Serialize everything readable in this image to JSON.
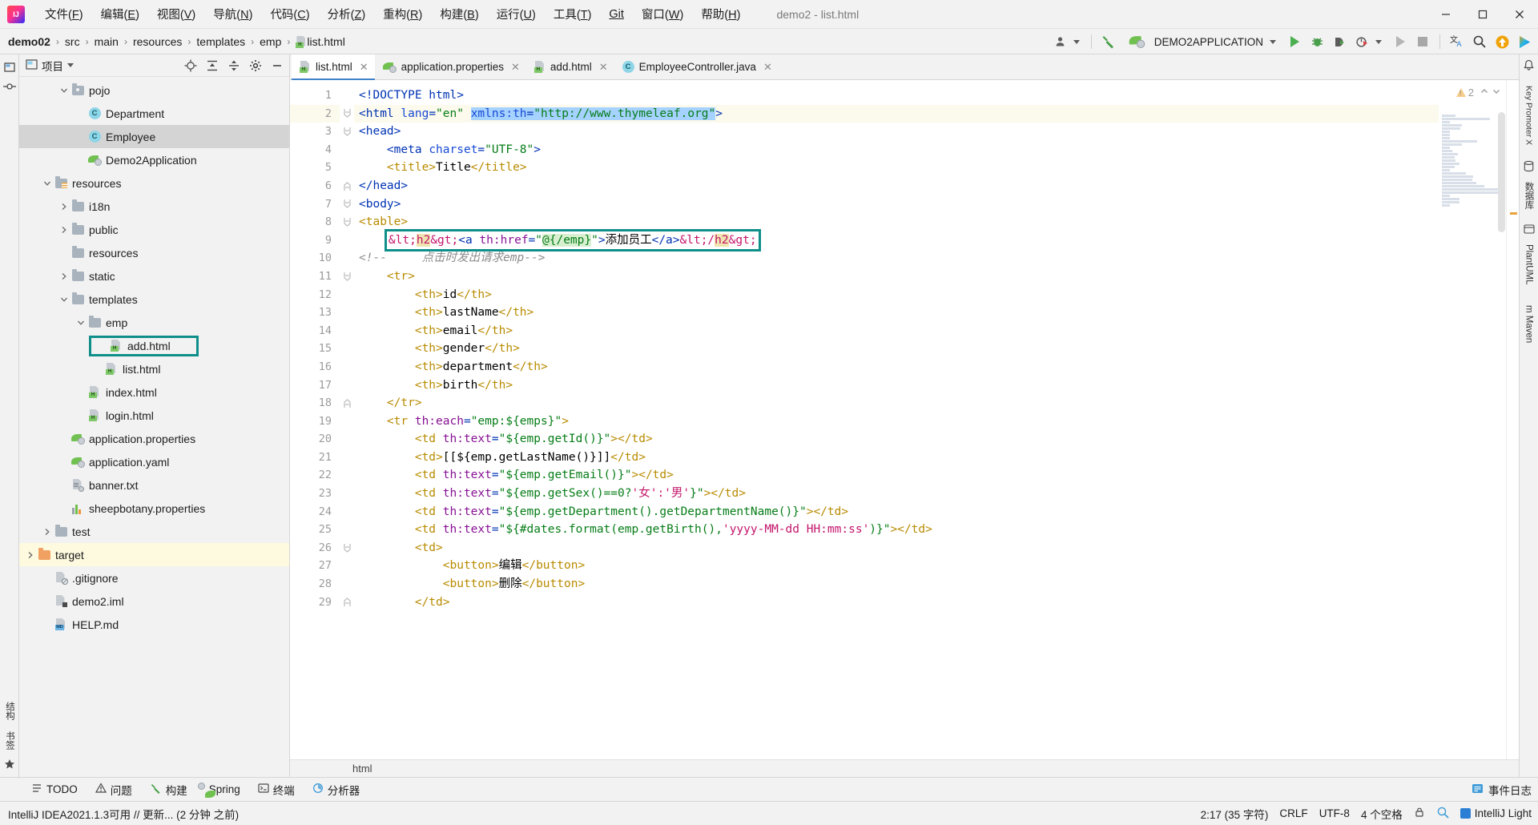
{
  "window": {
    "title": "demo2 - list.html",
    "controls": [
      "minimize",
      "maximize",
      "close"
    ]
  },
  "menubar": {
    "items": [
      {
        "label": "文件(F)",
        "name": "menu-file"
      },
      {
        "label": "编辑(E)",
        "name": "menu-edit"
      },
      {
        "label": "视图(V)",
        "name": "menu-view"
      },
      {
        "label": "导航(N)",
        "name": "menu-navigate"
      },
      {
        "label": "代码(C)",
        "name": "menu-code"
      },
      {
        "label": "分析(Z)",
        "name": "menu-analyze"
      },
      {
        "label": "重构(R)",
        "name": "menu-refactor"
      },
      {
        "label": "构建(B)",
        "name": "menu-build"
      },
      {
        "label": "运行(U)",
        "name": "menu-run"
      },
      {
        "label": "工具(T)",
        "name": "menu-tools"
      },
      {
        "label": "Git",
        "name": "menu-git"
      },
      {
        "label": "窗口(W)",
        "name": "menu-window"
      },
      {
        "label": "帮助(H)",
        "name": "menu-help"
      }
    ]
  },
  "breadcrumbs": {
    "items": [
      "demo02",
      "src",
      "main",
      "resources",
      "templates",
      "emp",
      "list.html"
    ],
    "separator": "›"
  },
  "toolbar": {
    "run_config": "DEMO2APPLICATION",
    "icons": [
      "user-icon",
      "hammer-build-icon",
      "spring-boot-icon",
      "run-icon",
      "debug-icon",
      "run-with-coverage-icon",
      "profile-icon",
      "rerun-icon",
      "stop-icon",
      "translate-icon",
      "search-everywhere-icon",
      "update-project-icon",
      "ide-features-icon"
    ]
  },
  "project_panel": {
    "title": "项目",
    "header_icons": [
      "locate-icon",
      "expand-all-icon",
      "collapse-all-icon",
      "settings-icon",
      "hide-icon"
    ],
    "tree": [
      {
        "label": "pojo",
        "indent": 3,
        "icon": "package-folder-icon",
        "twist": "down",
        "state": "normal"
      },
      {
        "label": "Department",
        "indent": 4,
        "icon": "class-icon",
        "twist": "none",
        "state": "normal"
      },
      {
        "label": "Employee",
        "indent": 4,
        "icon": "class-icon",
        "twist": "none",
        "state": "selected"
      },
      {
        "label": "Demo2Application",
        "indent": 4,
        "icon": "spring-icon",
        "twist": "none",
        "state": "normal"
      },
      {
        "label": "resources",
        "indent": 2,
        "icon": "resource-folder-icon",
        "twist": "down",
        "state": "normal"
      },
      {
        "label": "i18n",
        "indent": 3,
        "icon": "folder-icon",
        "twist": "right",
        "state": "normal"
      },
      {
        "label": "public",
        "indent": 3,
        "icon": "folder-icon",
        "twist": "right",
        "state": "normal"
      },
      {
        "label": "resources",
        "indent": 3,
        "icon": "folder-icon",
        "twist": "none",
        "state": "normal"
      },
      {
        "label": "static",
        "indent": 3,
        "icon": "folder-icon",
        "twist": "right",
        "state": "normal"
      },
      {
        "label": "templates",
        "indent": 3,
        "icon": "folder-icon",
        "twist": "down",
        "state": "normal"
      },
      {
        "label": "emp",
        "indent": 4,
        "icon": "folder-icon",
        "twist": "down",
        "state": "normal"
      },
      {
        "label": "add.html",
        "indent": 5,
        "icon": "html-icon",
        "twist": "none",
        "state": "boxed"
      },
      {
        "label": "list.html",
        "indent": 5,
        "icon": "html-icon",
        "twist": "none",
        "state": "normal"
      },
      {
        "label": "index.html",
        "indent": 4,
        "icon": "html-icon",
        "twist": "none",
        "state": "normal"
      },
      {
        "label": "login.html",
        "indent": 4,
        "icon": "html-icon",
        "twist": "none",
        "state": "normal"
      },
      {
        "label": "application.properties",
        "indent": 3,
        "icon": "spring-icon",
        "twist": "none",
        "state": "normal"
      },
      {
        "label": "application.yaml",
        "indent": 3,
        "icon": "spring-icon",
        "twist": "none",
        "state": "normal"
      },
      {
        "label": "banner.txt",
        "indent": 3,
        "icon": "text-file-icon",
        "twist": "none",
        "state": "normal"
      },
      {
        "label": "sheepbotany.properties",
        "indent": 3,
        "icon": "properties-icon",
        "twist": "none",
        "state": "normal"
      },
      {
        "label": "test",
        "indent": 2,
        "icon": "folder-icon",
        "twist": "right",
        "state": "normal"
      },
      {
        "label": "target",
        "indent": 1,
        "icon": "folder-orange-icon",
        "twist": "right",
        "state": "highlight"
      },
      {
        "label": ".gitignore",
        "indent": 2,
        "icon": "gitignore-icon",
        "twist": "none",
        "state": "normal"
      },
      {
        "label": "demo2.iml",
        "indent": 2,
        "icon": "iml-icon",
        "twist": "none",
        "state": "normal"
      },
      {
        "label": "HELP.md",
        "indent": 2,
        "icon": "markdown-icon",
        "twist": "none",
        "state": "normal"
      }
    ]
  },
  "left_rail": {
    "items": [
      "项目",
      "提交",
      "结构",
      "书签"
    ]
  },
  "right_rail": {
    "items": [
      "Key Promoter X",
      "数据库",
      "PlantUML",
      "m Maven"
    ]
  },
  "editor": {
    "tabs": [
      {
        "label": "list.html",
        "icon": "html-icon",
        "active": true
      },
      {
        "label": "application.properties",
        "icon": "spring-icon",
        "active": false
      },
      {
        "label": "add.html",
        "icon": "html-icon",
        "active": false
      },
      {
        "label": "EmployeeController.java",
        "icon": "class-icon",
        "active": false
      }
    ],
    "inspection": {
      "warning_count": "2",
      "icon": "warning-triangle-icon"
    },
    "breadcrumb_bottom": "html",
    "current_line": 2,
    "lines": [
      {
        "n": 1,
        "fold": "none",
        "text": "<!DOCTYPE html>"
      },
      {
        "n": 2,
        "fold": "open",
        "text": "<html lang=\"en\" xmlns:th=\"http://www.thymeleaf.org\">"
      },
      {
        "n": 3,
        "fold": "open",
        "text": "<head>"
      },
      {
        "n": 4,
        "fold": "none",
        "text": "    <meta charset=\"UTF-8\">"
      },
      {
        "n": 5,
        "fold": "none",
        "text": "    <title>Title</title>"
      },
      {
        "n": 6,
        "fold": "close",
        "text": "</head>"
      },
      {
        "n": 7,
        "fold": "open",
        "text": "<body>"
      },
      {
        "n": 8,
        "fold": "open",
        "text": "<table>"
      },
      {
        "n": 9,
        "fold": "none",
        "text": "    <h2><a th:href=\"@{/emp}\">添加员工</a></h2>"
      },
      {
        "n": 10,
        "fold": "none",
        "text": "<!--     点击时发出请求emp-->"
      },
      {
        "n": 11,
        "fold": "open",
        "text": "    <tr>"
      },
      {
        "n": 12,
        "fold": "none",
        "text": "        <th>id</th>"
      },
      {
        "n": 13,
        "fold": "none",
        "text": "        <th>lastName</th>"
      },
      {
        "n": 14,
        "fold": "none",
        "text": "        <th>email</th>"
      },
      {
        "n": 15,
        "fold": "none",
        "text": "        <th>gender</th>"
      },
      {
        "n": 16,
        "fold": "none",
        "text": "        <th>department</th>"
      },
      {
        "n": 17,
        "fold": "none",
        "text": "        <th>birth</th>"
      },
      {
        "n": 18,
        "fold": "close",
        "text": "    </tr>"
      },
      {
        "n": 19,
        "fold": "none",
        "text": "    <tr th:each=\"emp:${emps}\">"
      },
      {
        "n": 20,
        "fold": "none",
        "text": "        <td th:text=\"${emp.getId()}\"></td>"
      },
      {
        "n": 21,
        "fold": "none",
        "text": "        <td>[[${emp.getLastName()}]]</td>"
      },
      {
        "n": 22,
        "fold": "none",
        "text": "        <td th:text=\"${emp.getEmail()}\"></td>"
      },
      {
        "n": 23,
        "fold": "none",
        "text": "        <td th:text=\"${emp.getSex()==0?'女':'男'}\"></td>"
      },
      {
        "n": 24,
        "fold": "none",
        "text": "        <td th:text=\"${emp.getDepartment().getDepartmentName()}\"></td>"
      },
      {
        "n": 25,
        "fold": "none",
        "text": "        <td th:text=\"${#dates.format(emp.getBirth(),'yyyy-MM-dd HH:mm:ss')}\"></td>"
      },
      {
        "n": 26,
        "fold": "open",
        "text": "        <td>"
      },
      {
        "n": 27,
        "fold": "none",
        "text": "            <button>编辑</button>"
      },
      {
        "n": 28,
        "fold": "none",
        "text": "            <button>删除</button>"
      },
      {
        "n": 29,
        "fold": "close",
        "text": "        </td>"
      }
    ]
  },
  "bottom_toolwindows": [
    {
      "label": "TODO",
      "icon": "todo-icon"
    },
    {
      "label": "问题",
      "icon": "problems-icon"
    },
    {
      "label": "构建",
      "icon": "build-icon"
    },
    {
      "label": "Spring",
      "icon": "spring-icon"
    },
    {
      "label": "终端",
      "icon": "terminal-icon"
    },
    {
      "label": "分析器",
      "icon": "profiler-icon"
    }
  ],
  "bottom_right": {
    "label": "事件日志",
    "icon": "event-log-icon"
  },
  "statusbar": {
    "message": "IntelliJ IDEA2021.1.3可用 // 更新... (2 分钟 之前)",
    "caret": "2:17 (35 字符)",
    "line_sep": "CRLF",
    "encoding": "UTF-8",
    "indent": "4 个空格",
    "theme": "IntelliJ Light",
    "icons": [
      "lock-icon",
      "inspection-icon",
      "theme-icon"
    ]
  },
  "colors": {
    "accent_teal": "#0f8f8a",
    "tab_underline": "#4083c9",
    "selection_blue": "#a6d2ff",
    "highlight_yellow": "#efe4b0",
    "highlight_green": "#d8f0d0",
    "tree_highlight": "#fdfadf",
    "tree_selected": "#d4d4d4"
  }
}
